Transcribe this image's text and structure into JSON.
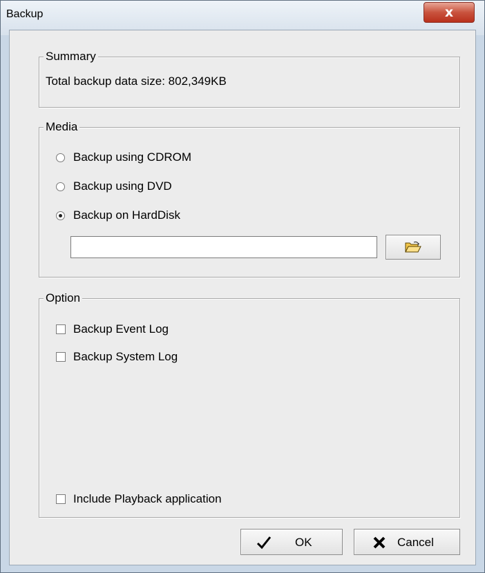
{
  "window": {
    "title": "Backup",
    "close_symbol": "x"
  },
  "summary": {
    "legend": "Summary",
    "size_label": "Total backup data size: 802,349KB"
  },
  "media": {
    "legend": "Media",
    "options": [
      {
        "label": "Backup using CDROM",
        "selected": false
      },
      {
        "label": "Backup using DVD",
        "selected": false
      },
      {
        "label": "Backup on HardDisk",
        "selected": true
      }
    ],
    "path_value": ""
  },
  "option": {
    "legend": "Option",
    "event_log_label": "Backup Event Log",
    "event_log_checked": false,
    "system_log_label": "Backup System Log",
    "system_log_checked": false,
    "playback_label": "Include Playback application",
    "playback_checked": false
  },
  "buttons": {
    "ok_label": "OK",
    "cancel_label": "Cancel"
  },
  "colors": {
    "title_bar": "#dbe5ef",
    "close_button": "#c7412c",
    "dialog_face": "#ececec"
  },
  "icons": {
    "browse": "open-folder-icon",
    "ok": "checkmark-icon",
    "cancel": "cross-icon"
  }
}
